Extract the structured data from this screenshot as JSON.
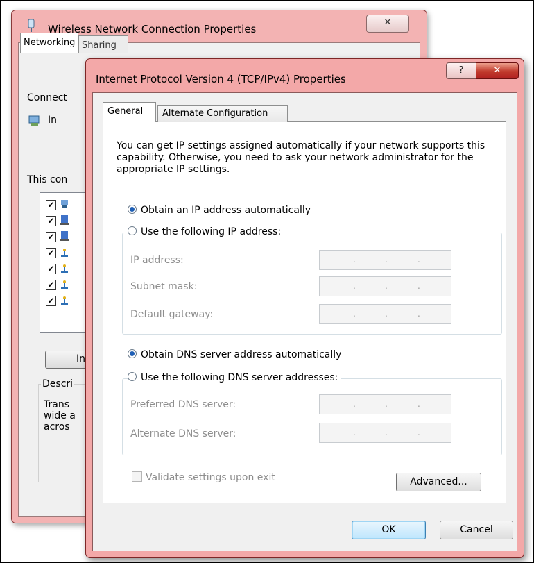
{
  "back_window": {
    "title": "Wireless Network Connection Properties",
    "close_glyph": "✕",
    "tabs": [
      "Networking",
      "Sharing"
    ],
    "connect_label": "Connect",
    "adapter_text": "In",
    "this_connection_label": "This con",
    "install_button_label": "In",
    "description_group_label": "Descri",
    "description_text": [
      "Trans",
      "wide a",
      "acros"
    ]
  },
  "dialog": {
    "title": "Internet Protocol Version 4 (TCP/IPv4) Properties",
    "help_glyph": "?",
    "close_glyph": "✕",
    "tabs": {
      "general": "General",
      "alternate": "Alternate Configuration"
    },
    "description": "You can get IP settings assigned automatically if your network supports this capability. Otherwise, you need to ask your network administrator for the appropriate IP settings.",
    "ip": {
      "auto_label": "Obtain an IP address automatically",
      "manual_label": "Use the following IP address:",
      "selected": "auto",
      "fields": {
        "ip_address": "IP address:",
        "subnet_mask": "Subnet mask:",
        "default_gateway": "Default gateway:"
      },
      "octet_separator": "."
    },
    "dns": {
      "auto_label": "Obtain DNS server address automatically",
      "manual_label": "Use the following DNS server addresses:",
      "selected": "auto",
      "fields": {
        "preferred": "Preferred DNS server:",
        "alternate": "Alternate DNS server:"
      }
    },
    "validate_label": "Validate settings upon exit",
    "validate_checked": false,
    "advanced_button": "Advanced...",
    "ok_button": "OK",
    "cancel_button": "Cancel"
  },
  "colors": {
    "window_frame": "#f3a8a8",
    "close_red": "#c0392b",
    "radio_selected": "#1f5fb5",
    "disabled_text": "#8e8e8e"
  }
}
